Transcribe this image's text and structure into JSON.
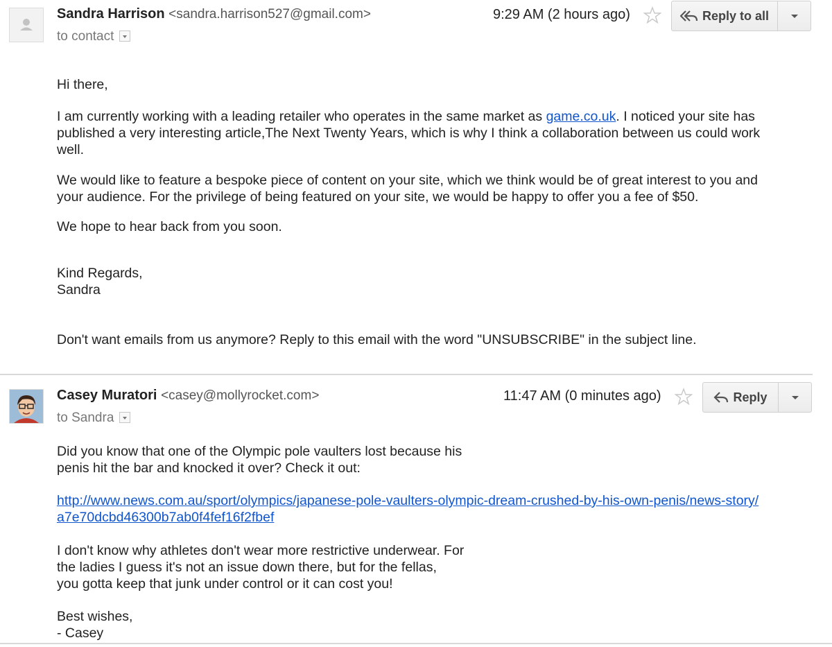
{
  "messages": [
    {
      "sender_name": "Sandra Harrison",
      "sender_email": "<sandra.harrison527@gmail.com>",
      "recipient": "to contact",
      "time": "9:29 AM (2 hours ago)",
      "action_label": "Reply to all",
      "avatar_icon": "default-avatar-icon",
      "body": {
        "greeting": "Hi there,",
        "p1_before_link": "I am currently working with a leading retailer who operates in the same market as ",
        "p1_link": "game.co.uk",
        "p1_after_link_line1": ". I noticed your site has",
        "p1_line2": "published a very interesting article,The Next Twenty Years, which is why I think a collaboration between us could work",
        "p1_line3": "well.",
        "p2_line1": "We would like to feature a bespoke piece of content on your site, which we think would be of great interest to you and",
        "p2_line2": "your audience. For the privilege of being featured on your site, we would be happy to offer you a fee of $50.",
        "p3": "We hope to hear back from you soon.",
        "signoff": "Kind Regards,",
        "signature": "Sandra",
        "footer": "Don't want emails from us anymore? Reply to this email with the word \"UNSUBSCRIBE\" in the subject line."
      }
    },
    {
      "sender_name": "Casey Muratori",
      "sender_email": "<casey@mollyrocket.com>",
      "recipient": "to Sandra",
      "time": "11:47 AM (0 minutes ago)",
      "action_label": "Reply",
      "avatar_icon": "user-photo-avatar",
      "body": {
        "p1_line1": "Did you know that one of the Olympic pole vaulters lost because his",
        "p1_line2": "penis hit the bar and knocked it over?  Check it out:",
        "link_line1": "http://www.news.com.au/sport/olympics/japanese-pole-vaulters-olympic-dream-crushed-by-his-own-penis/news-story/",
        "link_line2": "a7e70dcbd46300b7ab0f4fef16f2fbef",
        "p2_line1": "I don't know why athletes don't wear more restrictive underwear.  For",
        "p2_line2": "the ladies I guess it's not an issue down there, but for the fellas,",
        "p2_line3": "you gotta keep that junk under control or it can cost you!",
        "signoff": "Best wishes,",
        "signature": "- Casey"
      }
    }
  ],
  "colors": {
    "link": "#1155cc",
    "divider": "#d8d8d8",
    "button_bg": "#f1f1f1"
  }
}
